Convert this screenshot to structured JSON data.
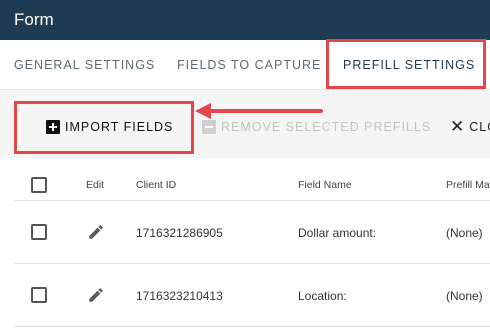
{
  "app": {
    "title": "Form"
  },
  "tabs": [
    {
      "label": "GENERAL SETTINGS",
      "active": false
    },
    {
      "label": "FIELDS TO CAPTURE",
      "active": false
    },
    {
      "label": "PREFILL SETTINGS",
      "active": true
    }
  ],
  "toolbar": {
    "import_label": "IMPORT FIELDS",
    "remove_label": "REMOVE SELECTED PREFILLS",
    "close_label": "CLO"
  },
  "table": {
    "columns": [
      "Edit",
      "Client ID",
      "Field Name",
      "Prefill Ma"
    ],
    "rows": [
      {
        "client_id": "1716321286905",
        "field_name": "Dollar amount:",
        "prefill": "(None)"
      },
      {
        "client_id": "1716323210413",
        "field_name": "Location:",
        "prefill": "(None)"
      }
    ]
  },
  "icons": {
    "import": "plus-box-icon",
    "remove": "minus-box-icon",
    "close": "close-icon",
    "edit": "pencil-icon",
    "annotation": "arrow-left-icon"
  },
  "colors": {
    "header_bg": "#1f3b52",
    "highlight": "#e0484b",
    "toolbar_bg": "#f5f5f5"
  }
}
